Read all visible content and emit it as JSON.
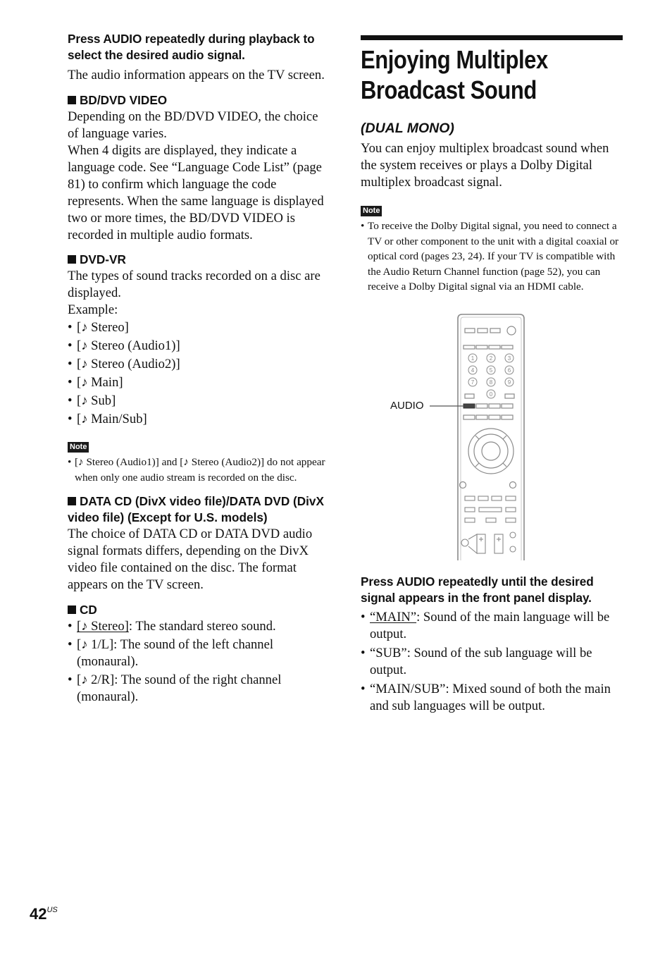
{
  "left": {
    "step1": "Press AUDIO repeatedly during playback to select the desired audio signal.",
    "step1_body": "The audio information appears on the TV screen.",
    "sections": {
      "bd": {
        "heading": "BD/DVD VIDEO",
        "p1": "Depending on the BD/DVD VIDEO, the choice of language varies.",
        "p2": "When 4 digits are displayed, they indicate a language code. See “Language Code List” (page 81) to confirm which language the code represents. When the same language is displayed two or more times, the BD/DVD VIDEO is recorded in multiple audio formats."
      },
      "dvdvr": {
        "heading": "DVD-VR",
        "p1": "The types of sound tracks recorded on a disc are displayed.",
        "example": "Example:",
        "items": [
          "[♪ Stereo]",
          "[♪ Stereo (Audio1)]",
          "[♪ Stereo (Audio2)]",
          "[♪ Main]",
          "[♪ Sub]",
          "[♪ Main/Sub]"
        ],
        "note_label": "Note",
        "note": "[♪ Stereo (Audio1)] and [♪ Stereo (Audio2)] do not appear when only one audio stream is recorded on the disc."
      },
      "datacd": {
        "heading": "DATA CD (DivX video file)/DATA DVD (DivX video file) (Except for U.S. models)",
        "p1": "The choice of DATA CD or DATA DVD audio signal formats differs, depending on the DivX video file contained on the disc. The format appears on the TV screen."
      },
      "cd": {
        "heading": "CD",
        "items": [
          {
            "term": "[♪ Stereo]",
            "desc": ": The standard stereo sound.",
            "default": true
          },
          {
            "term": "[♪ 1/L]",
            "desc": ": The sound of the left channel (monaural).",
            "default": false
          },
          {
            "term": "[♪ 2/R]",
            "desc": ": The sound of the right channel (monaural).",
            "default": false
          }
        ]
      }
    }
  },
  "right": {
    "title_line1": "Enjoying Multiplex",
    "title_line2": "Broadcast Sound",
    "subtitle": "(DUAL MONO)",
    "intro": "You can enjoy multiplex broadcast sound when the system receives or plays a Dolby Digital multiplex broadcast signal.",
    "note_label": "Note",
    "note": "To receive the Dolby Digital signal, you need to connect a TV or other component to the unit with a digital coaxial or optical cord (pages 23, 24). If your TV is compatible with the Audio Return Channel function (page 52), you can receive a Dolby Digital signal via an HDMI cable.",
    "figure_label": "AUDIO",
    "keypad_digits": [
      "1",
      "2",
      "3",
      "4",
      "5",
      "6",
      "7",
      "8",
      "9",
      "0"
    ],
    "step": "Press AUDIO repeatedly until the desired signal appears in the front panel display.",
    "items": [
      {
        "term": "“MAIN”",
        "desc": ": Sound of the main language will be output.",
        "default": true
      },
      {
        "term": "“SUB”",
        "desc": ": Sound of the sub language will be output.",
        "default": false
      },
      {
        "term": "“MAIN/SUB”",
        "desc": ": Mixed sound of both the main and sub languages will be output.",
        "default": false
      }
    ]
  },
  "footer": {
    "page_number": "42",
    "page_suffix": "US"
  }
}
